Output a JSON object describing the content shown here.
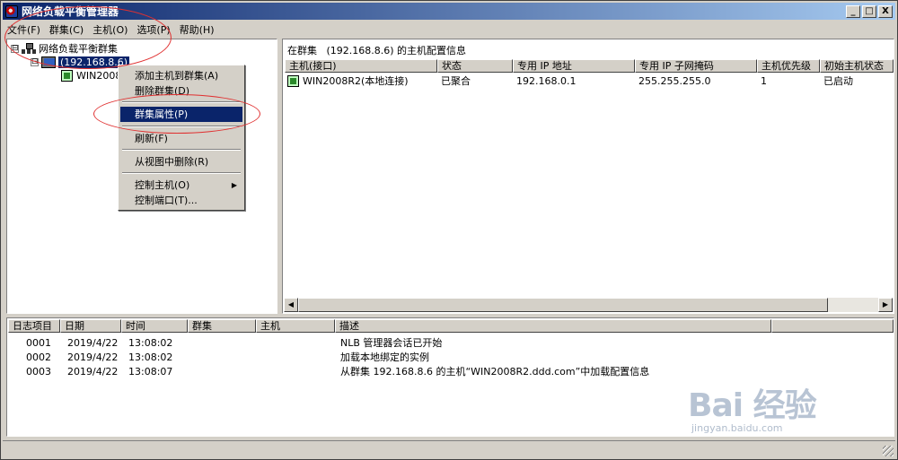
{
  "window": {
    "title": "网络负载平衡管理器",
    "minimize": "_",
    "maximize": "□",
    "close": "X"
  },
  "menu": [
    "文件(F)",
    "群集(C)",
    "主机(O)",
    "选项(P)",
    "帮助(H)"
  ],
  "tree": {
    "root_label": "网络负载平衡群集",
    "root_expander": "⊟",
    "cluster_label": "(192.168.8.6)",
    "cluster_expander": "⊟",
    "host_label": "WIN2008"
  },
  "context_menu": {
    "items": [
      {
        "label": "添加主机到群集(A)"
      },
      {
        "label": "删除群集(D)"
      },
      {
        "label": "群集属性(P)"
      },
      {
        "label": "刷新(F)"
      },
      {
        "label": "从视图中删除(R)"
      },
      {
        "label": "控制主机(O)",
        "submenu_arrow": "▶"
      },
      {
        "label": "控制端口(T)..."
      }
    ]
  },
  "right_pane": {
    "caption": "在群集   (192.168.8.6) 的主机配置信息",
    "columns": [
      "主机(接口)",
      "状态",
      "专用 IP 地址",
      "专用 IP 子网掩码",
      "主机优先级",
      "初始主机状态"
    ],
    "rows": [
      [
        "WIN2008R2(本地连接)",
        "已聚合",
        "192.168.0.1",
        "255.255.255.0",
        "1",
        "已启动"
      ]
    ],
    "scroll_left": "◀",
    "scroll_right": "▶"
  },
  "log": {
    "columns": [
      "日志项目",
      "日期",
      "时间",
      "群集",
      "主机",
      "描述"
    ],
    "rows": [
      [
        "0001",
        "2019/4/22",
        "13:08:02",
        "",
        "",
        "NLB 管理器会话已开始"
      ],
      [
        "0002",
        "2019/4/22",
        "13:08:02",
        "",
        "",
        "加载本地绑定的实例"
      ],
      [
        "0003",
        "2019/4/22",
        "13:08:07",
        "",
        "",
        "从群集 192.168.8.6 的主机“WIN2008R2.ddd.com”中加载配置信息"
      ]
    ]
  },
  "watermark": {
    "logo": "Bai  经验",
    "url": "jingyan.baidu.com"
  },
  "colors": {
    "title_bar": "#0a246a",
    "selection": "#0a246a",
    "face": "#d4d0c8",
    "annotation": "#e03030"
  }
}
